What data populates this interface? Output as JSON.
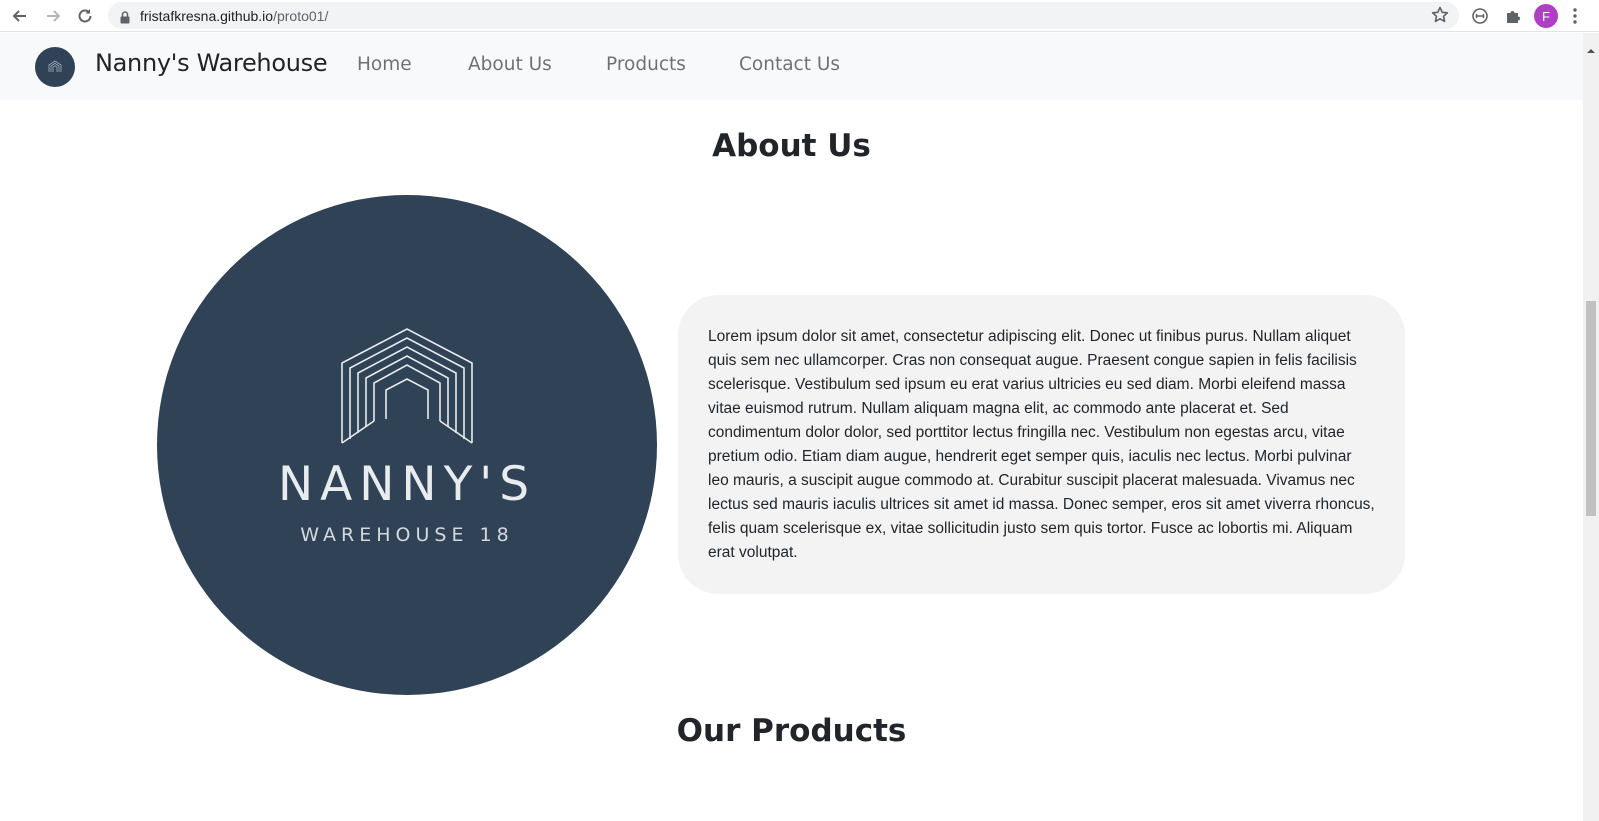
{
  "browser": {
    "url_host": "fristafkresna.github.io",
    "url_path": "/proto01/",
    "profile_initial": "F",
    "icons": [
      "back-icon",
      "forward-icon",
      "reload-icon",
      "lock-icon",
      "star-icon",
      "extension-circle-icon",
      "puzzle-icon",
      "kebab-menu-icon"
    ]
  },
  "navbar": {
    "brand": "Nanny's Warehouse",
    "links": [
      "Home",
      "About Us",
      "Products",
      "Contact Us"
    ]
  },
  "about": {
    "title": "About Us",
    "logo_word": "NANNY'S",
    "logo_sub": "WAREHOUSE 18",
    "body": "Lorem ipsum dolor sit amet, consectetur adipiscing elit. Donec ut finibus purus. Nullam aliquet quis sem nec ullamcorper. Cras non consequat augue. Praesent congue sapien in felis facilisis scelerisque. Vestibulum sed ipsum eu erat varius ultricies eu sed diam. Morbi eleifend massa vitae euismod rutrum. Nullam aliquam magna elit, ac commodo ante placerat et. Sed condimentum dolor dolor, sed porttitor lectus fringilla nec. Vestibulum non egestas arcu, vitae pretium odio. Etiam diam augue, hendrerit eget semper quis, iaculis nec lectus. Morbi pulvinar leo mauris, a suscipit augue commodo at. Curabitur suscipit placerat malesuada. Vivamus nec lectus sed mauris iaculis ultrices sit amet id massa. Donec semper, eros sit amet viverra rhoncus, felis quam scelerisque ex, vitae sollicitudin justo sem quis tortor. Fusce ac lobortis mi. Aliquam erat volutpat."
  },
  "products": {
    "title": "Our Products"
  },
  "colors": {
    "brand_navy": "#2f4256",
    "card_bg": "#f3f3f3",
    "nav_bg": "#f8f9fa",
    "profile": "#b03fc6"
  }
}
